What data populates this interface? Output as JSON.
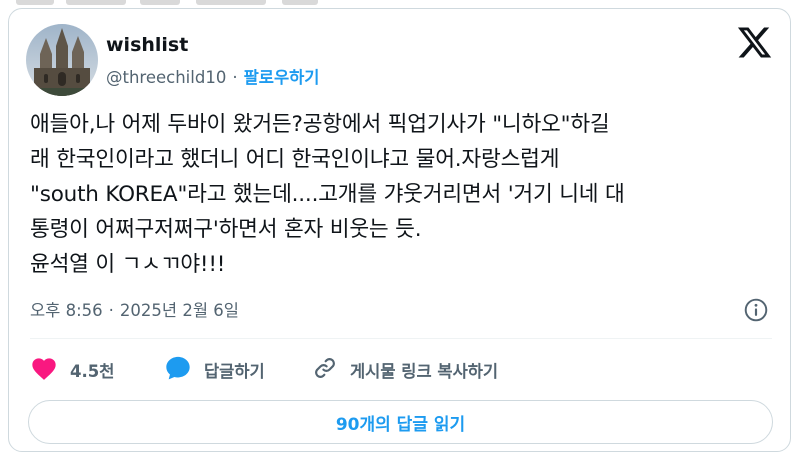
{
  "user": {
    "display_name": "wishlist",
    "handle": "@threechild10",
    "separator": "·",
    "follow_label": "팔로우하기"
  },
  "tweet": {
    "text": "애들아,나 어제 두바이 왔거든?공항에서 픽업기사가 \"니하오\"하길\n래 한국인이라고 했더니 어디 한국인이냐고 물어.자랑스럽게\n\"south KOREA\"라고 했는데....고개를 갸웃거리면서 '거기 니네 대\n통령이 어쩌구저쩌구'하면서 혼자 비웃는 듯.\n윤석열 이 ㄱㅅㄲ야!!!",
    "time": "오후 8:56",
    "separator": "·",
    "date": "2025년 2월 6일"
  },
  "actions": {
    "like_count": "4.5천",
    "reply_label": "답글하기",
    "copy_link_label": "게시물 링크 복사하기"
  },
  "replies_button": "90개의 답글 읽기",
  "icons": {
    "brand": "x-logo-icon",
    "info": "info-icon",
    "like": "heart-icon",
    "reply": "speech-bubble-icon",
    "link": "link-icon"
  },
  "colors": {
    "accent": "#1d9bf0",
    "like": "#f91880",
    "text": "#0f1419",
    "muted": "#536471",
    "border": "#cfd9de"
  }
}
